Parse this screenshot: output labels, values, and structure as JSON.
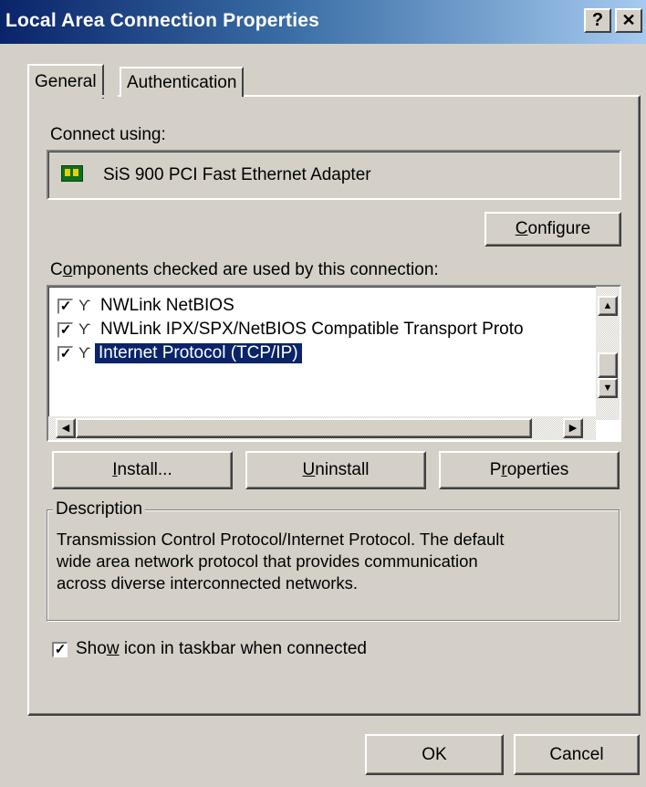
{
  "window": {
    "title": "Local Area Connection Properties",
    "help_glyph": "?",
    "close_glyph": "✕"
  },
  "tabs": [
    {
      "label": "General",
      "active": true
    },
    {
      "label": "Authentication",
      "active": false
    }
  ],
  "connect": {
    "label": "Connect using:",
    "adapter": "SiS 900 PCI Fast Ethernet Adapter",
    "adapter_icon": "network-card-icon"
  },
  "configure_button": {
    "label": "Configure",
    "accel": "C",
    "rest": "onfigure"
  },
  "components": {
    "label_accel": "o",
    "label_pre": "C",
    "label_post": "mponents checked are used by this connection:",
    "items": [
      {
        "label": "NWLink NetBIOS",
        "checked": true,
        "selected": false
      },
      {
        "label": "NWLink IPX/SPX/NetBIOS Compatible Transport Proto",
        "checked": true,
        "selected": false
      },
      {
        "label": "Internet Protocol (TCP/IP)",
        "checked": true,
        "selected": true
      }
    ]
  },
  "buttons": {
    "install": {
      "accel": "I",
      "rest": "nstall..."
    },
    "uninstall": {
      "accel": "U",
      "rest": "ninstall"
    },
    "properties": {
      "pre": "P",
      "accel": "r",
      "rest": "operties"
    }
  },
  "description": {
    "legend": "Description",
    "lines": [
      "Transmission Control Protocol/Internet Protocol. The default",
      "wide area network protocol that provides communication",
      "across diverse interconnected networks."
    ]
  },
  "show_icon": {
    "checked": true,
    "pre": "Sho",
    "accel": "w",
    "post": " icon in taskbar when connected"
  },
  "footer": {
    "ok": "OK",
    "cancel": "Cancel"
  },
  "colors": {
    "selection": "#0a246a",
    "title_start": "#0a246a",
    "title_end": "#a6caf0"
  }
}
